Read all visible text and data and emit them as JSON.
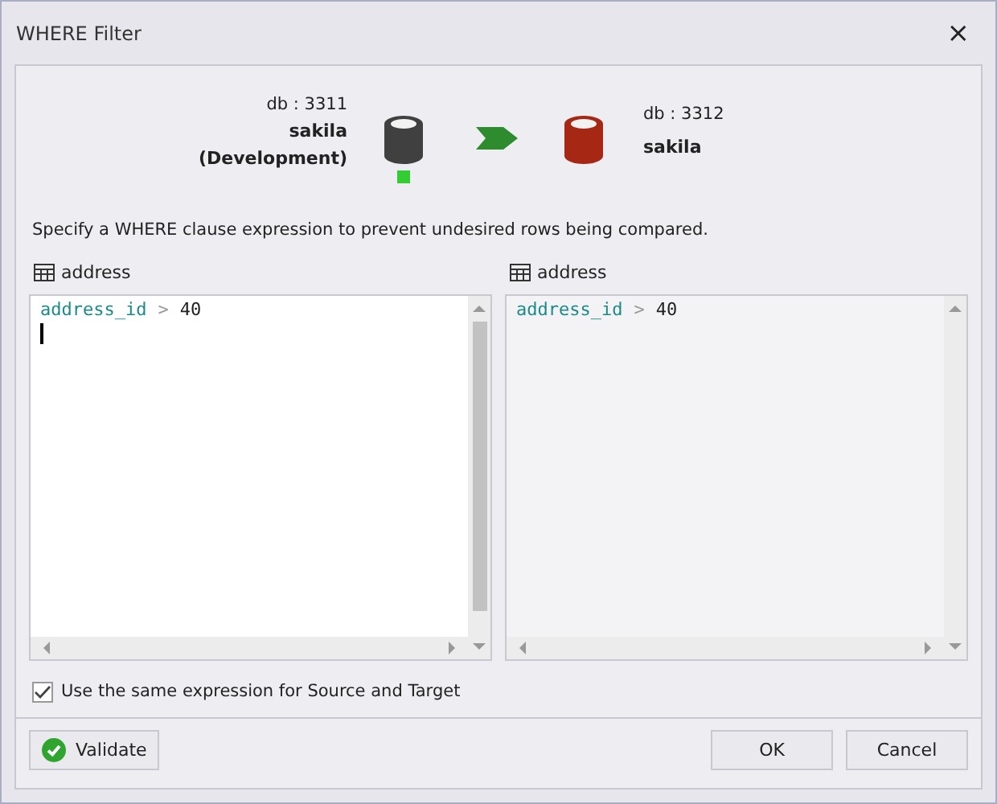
{
  "window": {
    "title": "WHERE Filter",
    "close": "×"
  },
  "source": {
    "db": "db : 3311",
    "name": "sakila",
    "env": "(Development)",
    "color": "#404040",
    "connected": true
  },
  "target": {
    "db": "db : 3312",
    "name": "sakila",
    "color": "#a52714"
  },
  "description": "Specify a WHERE clause expression to prevent undesired rows being compared.",
  "editors": [
    {
      "table": "address",
      "disabled": false,
      "focused": true,
      "tokens": [
        {
          "kind": "identifier",
          "text": "address_id"
        },
        {
          "kind": "operator",
          "text": ">"
        },
        {
          "kind": "number",
          "text": "40"
        }
      ]
    },
    {
      "table": "address",
      "disabled": true,
      "focused": false,
      "tokens": [
        {
          "kind": "identifier",
          "text": "address_id"
        },
        {
          "kind": "operator",
          "text": ">"
        },
        {
          "kind": "number",
          "text": "40"
        }
      ]
    }
  ],
  "same_expression": {
    "label": "Use the same expression for Source and Target",
    "checked": true
  },
  "buttons": [
    {
      "kind": "validate",
      "label": "Validate"
    },
    {
      "kind": "ok",
      "label": "OK"
    },
    {
      "kind": "cancel",
      "label": "Cancel"
    }
  ]
}
